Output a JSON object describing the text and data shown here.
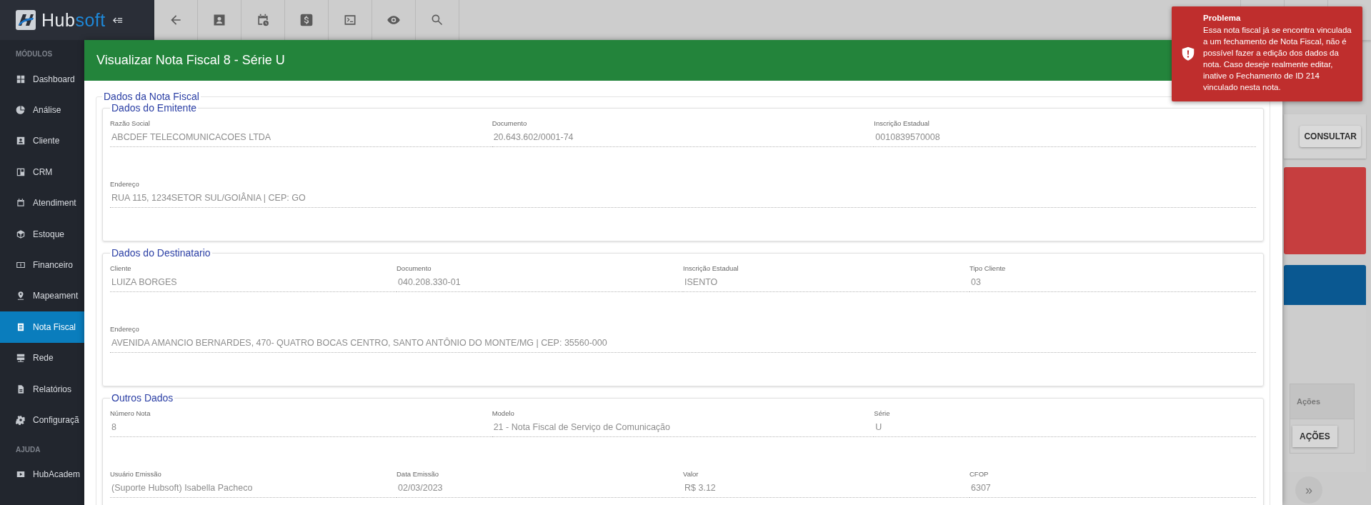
{
  "sidebar": {
    "brand_first": "Hub",
    "brand_second": "soft",
    "sections": [
      {
        "title": "MÓDULOS",
        "items": [
          {
            "label": "Dashboard",
            "selected": false
          },
          {
            "label": "Análise",
            "selected": false
          },
          {
            "label": "Cliente",
            "selected": false
          },
          {
            "label": "CRM",
            "selected": false
          },
          {
            "label": "Atendiment",
            "selected": false
          },
          {
            "label": "Estoque",
            "selected": false
          },
          {
            "label": "Financeiro",
            "selected": false
          },
          {
            "label": "Mapeament",
            "selected": false
          },
          {
            "label": "Nota Fiscal",
            "selected": true
          },
          {
            "label": "Rede",
            "selected": false
          },
          {
            "label": "Relatórios",
            "selected": false
          },
          {
            "label": "Configuraçã",
            "selected": false
          }
        ]
      },
      {
        "title": "AJUDA",
        "items": [
          {
            "label": "HubAcadem",
            "selected": false
          }
        ]
      }
    ]
  },
  "dialog": {
    "title": "Visualizar Nota Fiscal 8 - Série U",
    "legend": "Dados da Nota Fiscal",
    "groups": [
      {
        "legend": "Dados do Emitente",
        "rows": [
          {
            "fields": [
              {
                "label": "Razão Social",
                "value": "ABCDEF TELECOMUNICACOES LTDA"
              },
              {
                "label": "Documento",
                "value": "20.643.602/0001-74"
              },
              {
                "label": "Inscrição Estadual",
                "value": "0010839570008"
              }
            ]
          },
          {
            "fields": [
              {
                "label": "Endereço",
                "value": "RUA 115, 1234SETOR SUL/GOIÂNIA | CEP: GO"
              }
            ]
          }
        ]
      },
      {
        "legend": "Dados do Destinatario",
        "rows": [
          {
            "fields": [
              {
                "label": "Cliente",
                "value": "LUIZA BORGES"
              },
              {
                "label": "Documento",
                "value": "040.208.330-01"
              },
              {
                "label": "Inscrição Estadual",
                "value": "ISENTO"
              },
              {
                "label": "Tipo Cliente",
                "value": "03"
              }
            ]
          },
          {
            "fields": [
              {
                "label": "Endereço",
                "value": "AVENIDA AMANCIO BERNARDES, 470- QUATRO BOCAS CENTRO, SANTO ANTÔNIO DO MONTE/MG | CEP: 35560-000"
              }
            ]
          }
        ]
      },
      {
        "legend": "Outros Dados",
        "rows": [
          {
            "fields": [
              {
                "label": "Número Nota",
                "value": "8"
              },
              {
                "label": "Modelo",
                "value": "21 - Nota Fiscal de Serviço de Comunicação"
              },
              {
                "label": "Série",
                "value": "U"
              }
            ]
          },
          {
            "fields": [
              {
                "label": "Usuário Emissão",
                "value": "(Suporte Hubsoft) Isabella Pacheco"
              },
              {
                "label": "Data Emissão",
                "value": "02/03/2023"
              },
              {
                "label": "Valor",
                "value": "R$ 3.12"
              },
              {
                "label": "CFOP",
                "value": "6307"
              }
            ]
          }
        ]
      }
    ]
  },
  "background": {
    "consult_button": "CONSULTAR",
    "table_column": "Ações",
    "action_button": "AÇÕES",
    "pager_next": "»"
  },
  "toast": {
    "title": "Problema",
    "message": "Essa nota fiscal já se encontra vinculada a um fechamento de Nota Fiscal, não é possível fazer a edição dos dados da nota. Caso deseje realmente editar, inative o Fechamento de ID 214 vinculado nesta nota."
  }
}
